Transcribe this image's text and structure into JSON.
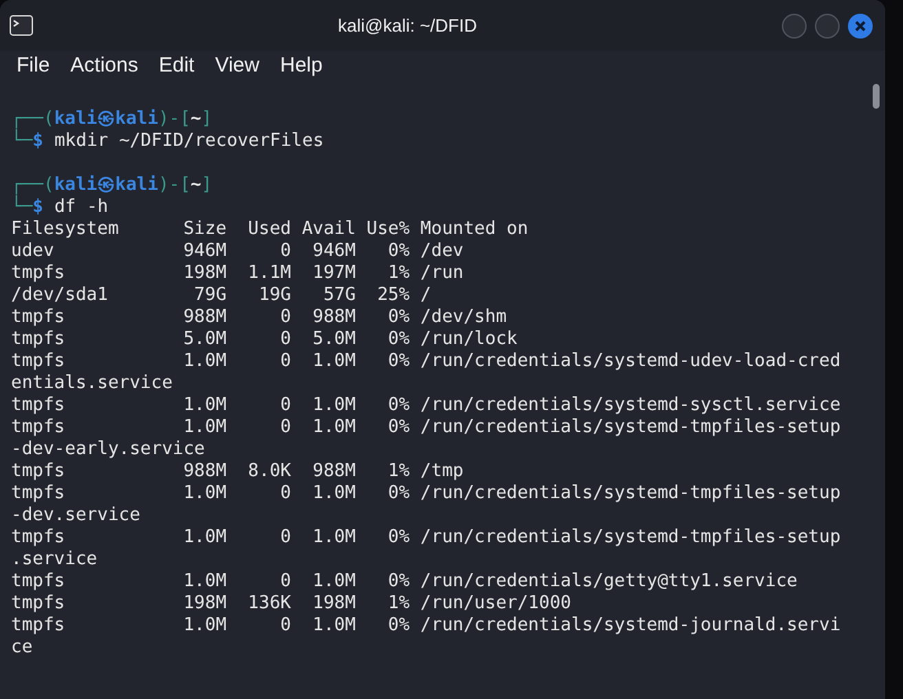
{
  "window": {
    "title": "kali@kali: ~/DFID"
  },
  "menu": [
    "File",
    "Actions",
    "Edit",
    "View",
    "Help"
  ],
  "session": [
    {
      "prompt": {
        "frame_top": "┌──(",
        "user": "kali",
        "at": "㉿",
        "host": "kali",
        "mid": ")-[",
        "dir": "~",
        "end": "]",
        "frame_bottom": "└─",
        "symbol": "$",
        "command": "mkdir ~/DFID/recoverFiles"
      }
    },
    {
      "prompt": {
        "frame_top": "┌──(",
        "user": "kali",
        "at": "㉿",
        "host": "kali",
        "mid": ")-[",
        "dir": "~",
        "end": "]",
        "frame_bottom": "└─",
        "symbol": "$",
        "command": "df -h"
      },
      "output": [
        "Filesystem      Size  Used Avail Use% Mounted on",
        "udev            946M     0  946M   0% /dev",
        "tmpfs           198M  1.1M  197M   1% /run",
        "/dev/sda1        79G   19G   57G  25% /",
        "tmpfs           988M     0  988M   0% /dev/shm",
        "tmpfs           5.0M     0  5.0M   0% /run/lock",
        "tmpfs           1.0M     0  1.0M   0% /run/credentials/systemd-udev-load-cred",
        "entials.service",
        "tmpfs           1.0M     0  1.0M   0% /run/credentials/systemd-sysctl.service",
        "tmpfs           1.0M     0  1.0M   0% /run/credentials/systemd-tmpfiles-setup",
        "-dev-early.service",
        "tmpfs           988M  8.0K  988M   1% /tmp",
        "tmpfs           1.0M     0  1.0M   0% /run/credentials/systemd-tmpfiles-setup",
        "-dev.service",
        "tmpfs           1.0M     0  1.0M   0% /run/credentials/systemd-tmpfiles-setup",
        ".service",
        "tmpfs           1.0M     0  1.0M   0% /run/credentials/getty@tty1.service",
        "tmpfs           198M  136K  198M   1% /run/user/1000",
        "tmpfs           1.0M     0  1.0M   0% /run/credentials/systemd-journald.servi",
        "ce"
      ]
    }
  ]
}
